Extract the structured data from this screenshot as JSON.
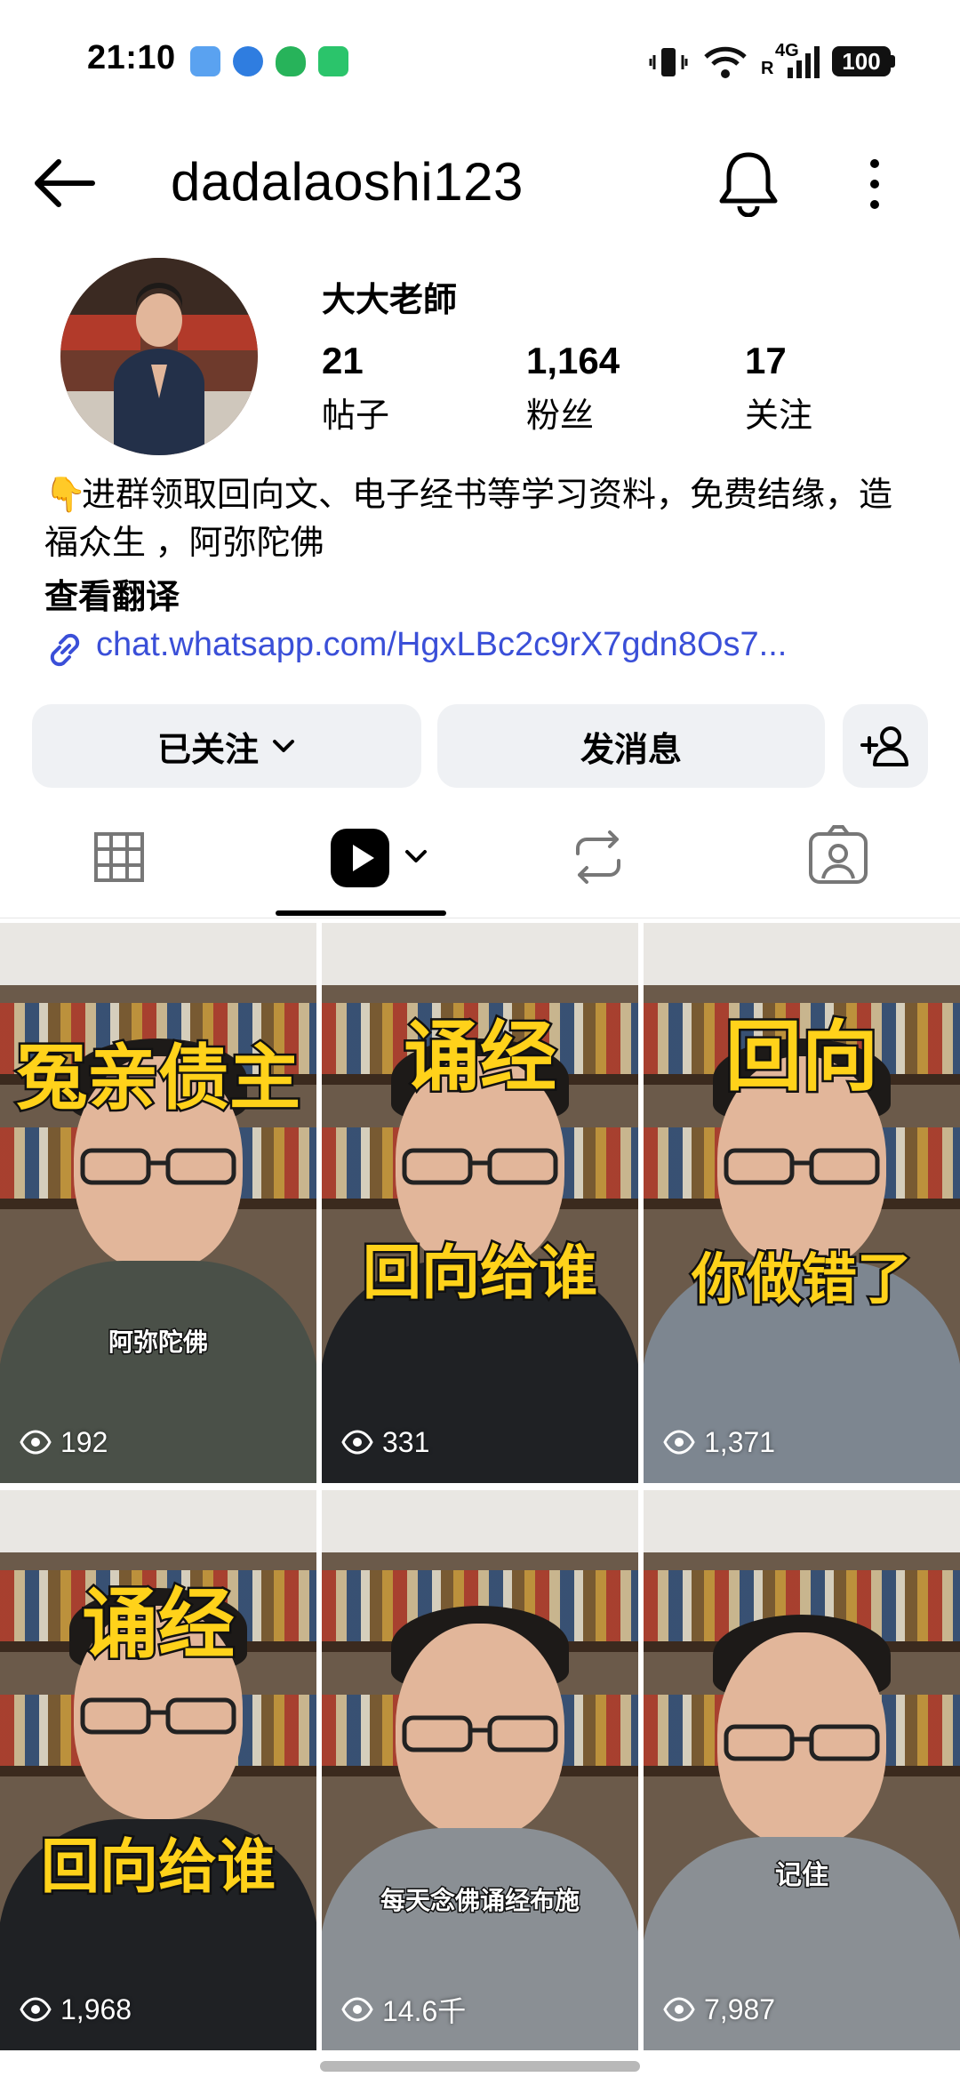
{
  "status_bar": {
    "time": "21:10",
    "network": "4G",
    "roaming": "R",
    "battery": "100"
  },
  "header": {
    "username": "dadalaoshi123"
  },
  "profile": {
    "display_name": "大大老師",
    "stats": [
      {
        "value": "21",
        "label": "帖子"
      },
      {
        "value": "1,164",
        "label": "粉丝"
      },
      {
        "value": "17",
        "label": "关注"
      }
    ],
    "bio_emoji": "👇",
    "bio": "进群领取回向文、电子经书等学习资料，免费结缘，造福众生 ，阿弥陀佛",
    "see_translation": "查看翻译",
    "link": "chat.whatsapp.com/HgxLBc2c9rX7gdn8Os7..."
  },
  "actions": {
    "following_label": "已关注",
    "message_label": "发消息"
  },
  "colors": {
    "link": "#3a4fd8",
    "button_bg": "#eff1f4",
    "caption_yellow": "#ffd21a"
  },
  "tabs": [
    {
      "name": "grid",
      "icon": "grid-icon",
      "active": false
    },
    {
      "name": "reels",
      "icon": "reels-icon",
      "active": true
    },
    {
      "name": "reposts",
      "icon": "repost-icon",
      "active": false
    },
    {
      "name": "tagged",
      "icon": "tagged-icon",
      "active": false
    }
  ],
  "reels": [
    {
      "caption_top": "冤亲债主",
      "caption_small": "阿弥陀佛",
      "caption_bottom": "",
      "views": "192"
    },
    {
      "caption_top": "诵经",
      "caption_small": "",
      "caption_bottom": "回向给谁",
      "views": "331"
    },
    {
      "caption_top": "回向",
      "caption_small": "",
      "caption_bottom": "你做错了",
      "views": "1,371"
    },
    {
      "caption_top": "诵经",
      "caption_small": "",
      "caption_bottom": "回向给谁",
      "views": "1,968"
    },
    {
      "caption_top": "",
      "caption_small": "每天念佛诵经布施",
      "caption_bottom": "",
      "views": "14.6千"
    },
    {
      "caption_top": "",
      "caption_small": "记住",
      "caption_bottom": "",
      "views": "7,987"
    }
  ]
}
